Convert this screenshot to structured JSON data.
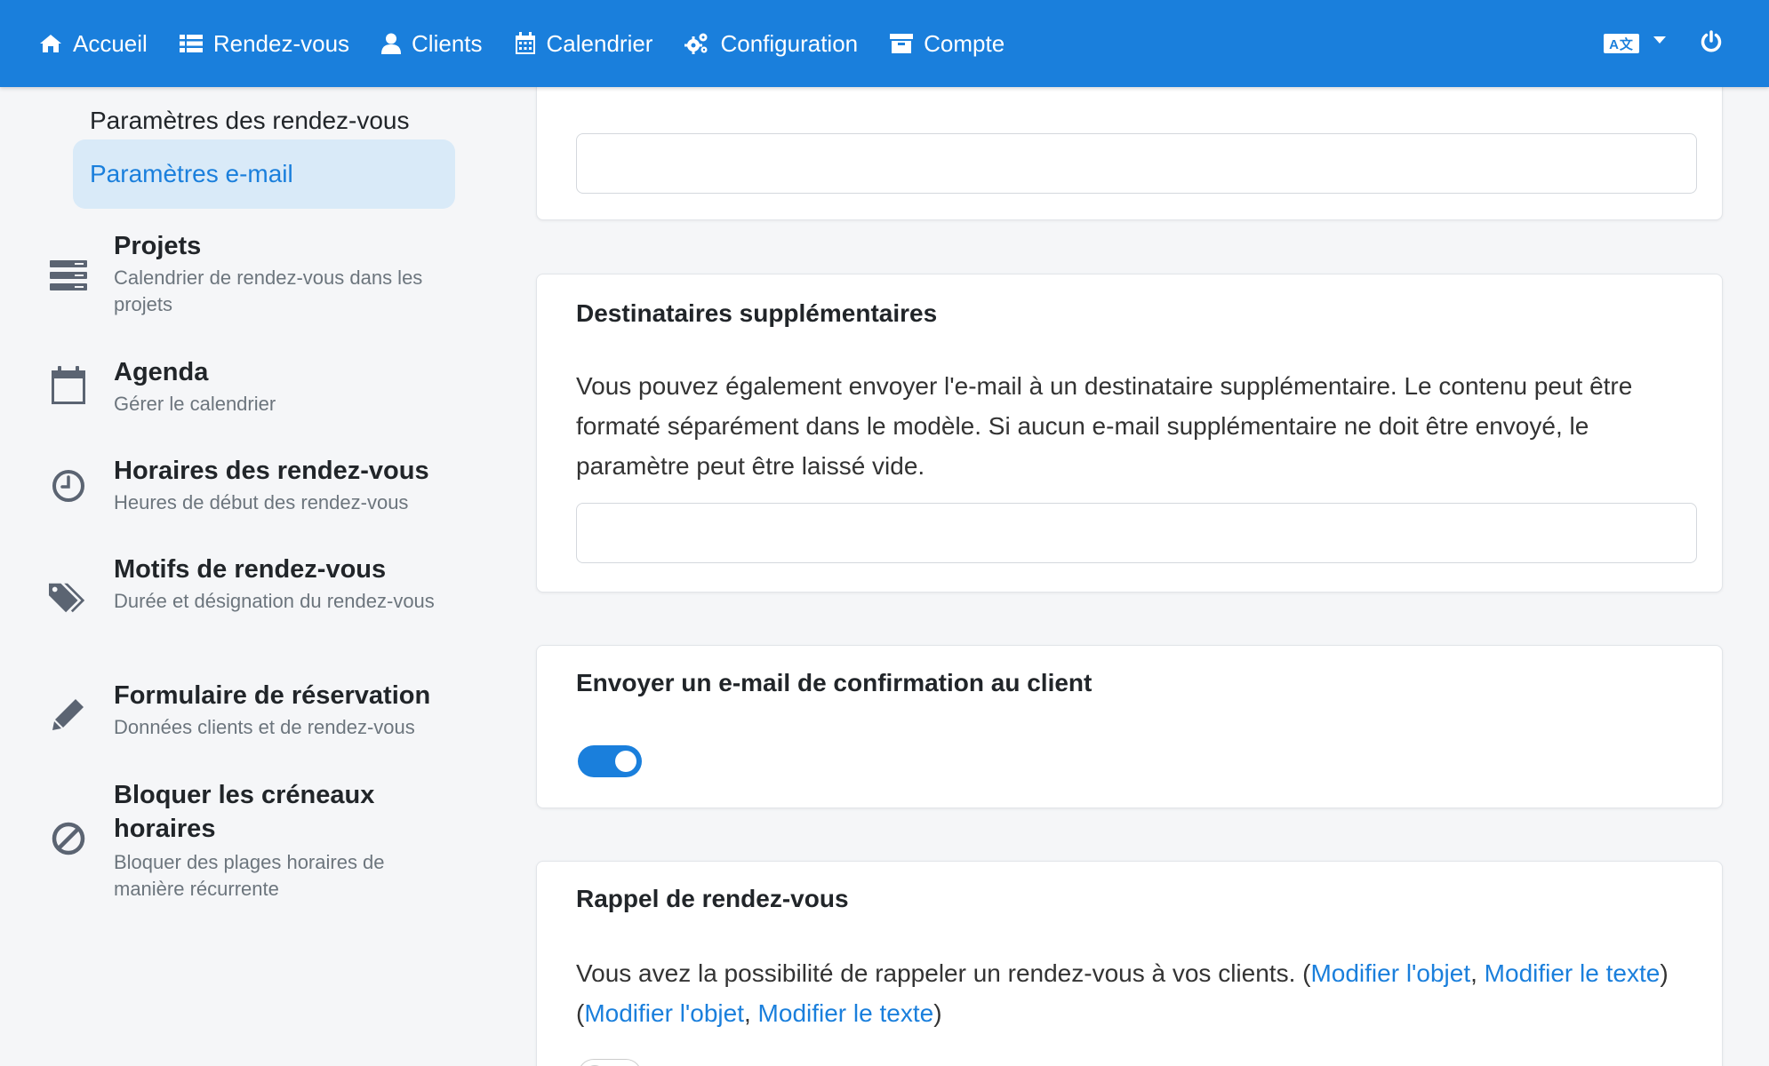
{
  "navbar": {
    "items": [
      {
        "label": "Accueil",
        "icon": "home-icon"
      },
      {
        "label": "Rendez-vous",
        "icon": "list-icon"
      },
      {
        "label": "Clients",
        "icon": "user-icon"
      },
      {
        "label": "Calendrier",
        "icon": "calendar-icon"
      },
      {
        "label": "Configuration",
        "icon": "gears-icon"
      },
      {
        "label": "Compte",
        "icon": "archive-icon"
      }
    ],
    "language_icon_text": "A文",
    "color": "#1a7fdc"
  },
  "sidebar": {
    "sub_items": [
      {
        "label": "Paramètres des rendez-vous"
      },
      {
        "label": "Paramètres e-mail",
        "active": true
      }
    ],
    "items": [
      {
        "title": "Projets",
        "desc": "Calendrier de rendez-vous dans les projets",
        "icon": "server-icon"
      },
      {
        "title": "Agenda",
        "desc": "Gérer le calendrier",
        "icon": "calendar-outline-icon"
      },
      {
        "title": "Horaires des rendez-vous",
        "desc": "Heures de début des rendez-vous",
        "icon": "clock-icon"
      },
      {
        "title": "Motifs de rendez-vous",
        "desc": "Durée et désignation du rendez-vous",
        "icon": "tags-icon"
      },
      {
        "title": "Formulaire de réservation",
        "desc": "Données clients et de rendez-vous",
        "icon": "pencil-icon"
      },
      {
        "title": "Bloquer les créneaux horaires",
        "desc": "Bloquer des plages horaires de manière récurrente",
        "icon": "ban-icon"
      }
    ]
  },
  "cards": {
    "top": {
      "input_value": ""
    },
    "recipients": {
      "title": "Destinataires supplémentaires",
      "text": "Vous pouvez également envoyer l'e-mail à un destinataire supplémentaire. Le contenu peut être formaté séparément dans le modèle. Si aucun e-mail supplémentaire ne doit être envoyé, le paramètre peut être laissé vide.",
      "input_value": ""
    },
    "confirmation": {
      "title": "Envoyer un e-mail de confirmation au client",
      "toggle_on": true
    },
    "reminder": {
      "title": "Rappel de rendez-vous",
      "text_before": "Vous avez la possibilité de rappeler un rendez-vous à vos clients. (",
      "link1": "Modifier l'objet",
      "sep1": ", ",
      "link2": "Modifier le texte",
      "mid": ") (",
      "link3": "Modifier l'objet",
      "sep2": ", ",
      "link4": "Modifier le texte",
      "end": ")",
      "toggle_on": false
    }
  }
}
